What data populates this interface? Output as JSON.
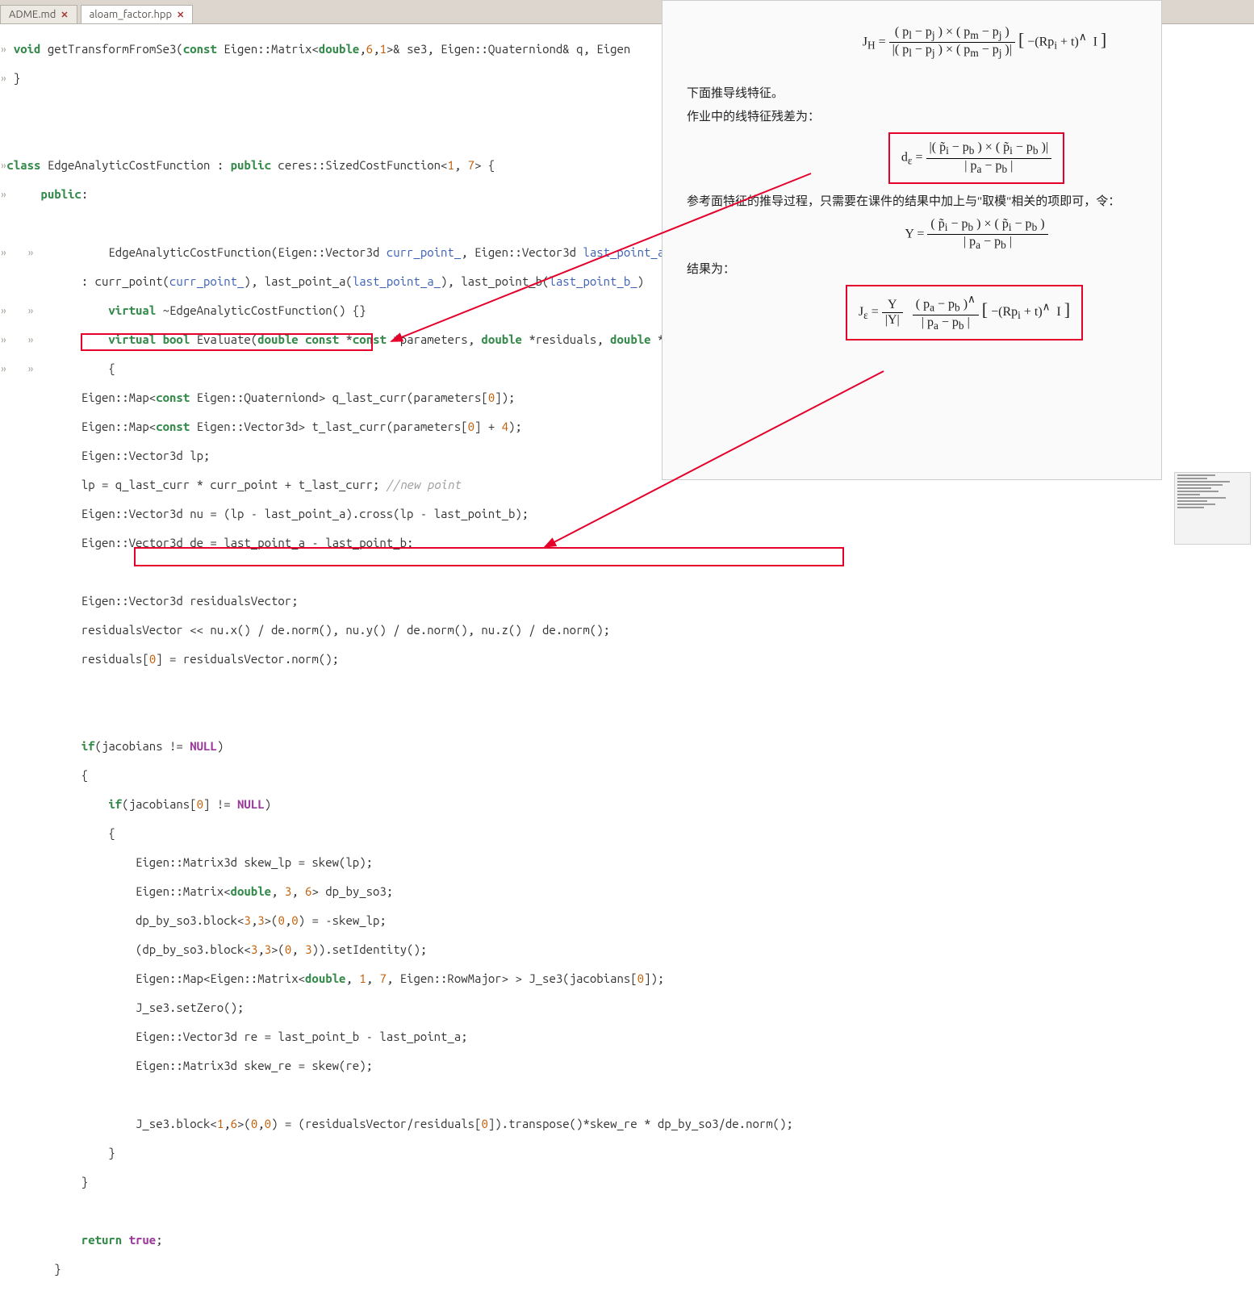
{
  "tabs": [
    {
      "label": "ADME.md",
      "active": false
    },
    {
      "label": "aloam_factor.hpp",
      "active": true
    }
  ],
  "code": {
    "l01": "void",
    "l01b": " getTransformFromSe3(",
    "l01c": "const",
    "l01d": " Eigen::Matrix<",
    "l01e": "double",
    "l01f": ",",
    "l01g": "6",
    "l01h": ",",
    "l01i": "1",
    "l01j": ">& se3, Eigen::Quaterniond& q, Eigen",
    "l02": "}",
    "l04a": "class",
    "l04b": " EdgeAnalyticCostFunction : ",
    "l04c": "public",
    "l04d": " ceres::SizedCostFunction<",
    "l04e": "1",
    "l04f": ", ",
    "l04g": "7",
    "l04h": "> {",
    "l05a": "    public",
    "l05b": ":",
    "l07": "        EdgeAnalyticCostFunction(Eigen::Vector3d ",
    "l07b": "curr_point_",
    "l07c": ", Eigen::Vector3d ",
    "l07d": "last_point_a_",
    "l08": "            : curr_point(",
    "l08b": "curr_point_",
    "l08c": "), last_point_a(",
    "l08d": "last_point_a_",
    "l08e": "), last_point_b(",
    "l08f": "last_point_b_",
    "l08g": ")",
    "l09a": "        virtual",
    "l09b": " ~EdgeAnalyticCostFunction() {}",
    "l10a": "        virtual",
    "l10b": " ",
    "l10c": "bool",
    "l10d": " Evaluate(",
    "l10e": "double",
    "l10f": " ",
    "l10g": "const",
    "l10h": " *",
    "l10i": "const",
    "l10j": " *parameters, ",
    "l10k": "double",
    "l10l": " *residuals, ",
    "l10m": "double",
    "l10n": " **",
    "l11": "        {",
    "l12a": "            Eigen::Map<",
    "l12b": "const",
    "l12c": " Eigen::Quaterniond> q_last_curr(parameters[",
    "l12d": "0",
    "l12e": "]);",
    "l13a": "            Eigen::Map<",
    "l13b": "const",
    "l13c": " Eigen::Vector3d> t_last_curr(parameters[",
    "l13d": "0",
    "l13e": "] + ",
    "l13f": "4",
    "l13g": ");",
    "l14": "            Eigen::Vector3d lp;",
    "l15a": "            lp = q_last_curr * curr_point + t_last_curr; ",
    "l15b": "//new point",
    "l16": "            Eigen::Vector3d nu = (lp - last_point_a).cross(lp - last_point_b);",
    "l17": "            Eigen::Vector3d de = last_point_a - last_point_b;",
    "l19": "            Eigen::Vector3d residualsVector;",
    "l20": "            residualsVector << nu.x() / de.norm(), nu.y() / de.norm(), nu.z() / de.norm();",
    "l21a": "            residuals[",
    "l21b": "0",
    "l21c": "] = residualsVector.norm();",
    "l24a": "            if",
    "l24b": "(jacobians != ",
    "l24c": "NULL",
    "l24d": ")",
    "l25": "            {",
    "l26a": "                if",
    "l26b": "(jacobians[",
    "l26c": "0",
    "l26d": "] != ",
    "l26e": "NULL",
    "l26f": ")",
    "l27": "                {",
    "l28": "                    Eigen::Matrix3d skew_lp = skew(lp);",
    "l29a": "                    Eigen::Matrix<",
    "l29b": "double",
    "l29c": ", ",
    "l29d": "3",
    "l29e": ", ",
    "l29f": "6",
    "l29g": "> dp_by_so3;",
    "l30a": "                    dp_by_so3.block<",
    "l30b": "3",
    "l30c": ",",
    "l30d": "3",
    "l30e": ">(",
    "l30f": "0",
    "l30g": ",",
    "l30h": "0",
    "l30i": ") = -skew_lp;",
    "l31a": "                    (dp_by_so3.block<",
    "l31b": "3",
    "l31c": ",",
    "l31d": "3",
    "l31e": ">(",
    "l31f": "0",
    "l31g": ", ",
    "l31h": "3",
    "l31i": ")).setIdentity();",
    "l32a": "                    Eigen::Map<Eigen::Matrix<",
    "l32b": "double",
    "l32c": ", ",
    "l32d": "1",
    "l32e": ", ",
    "l32f": "7",
    "l32g": ", Eigen::RowMajor> > J_se3(jacobians[",
    "l32h": "0",
    "l32i": "]);",
    "l33": "                    J_se3.setZero();",
    "l34": "                    Eigen::Vector3d re = last_point_b - last_point_a;",
    "l35": "                    Eigen::Matrix3d skew_re = skew(re);",
    "l37a": "                    J_se3.block<",
    "l37b": "1",
    "l37c": ",",
    "l37d": "6",
    "l37e": ">(",
    "l37f": "0",
    "l37g": ",",
    "l37h": "0",
    "l37i": ") = (residualsVector/residuals[",
    "l37j": "0",
    "l37k": "]).transpose()*skew_re * dp_by_so3/de.norm();",
    "l38": "                }",
    "l39": "            }",
    "l41a": "            return",
    "l41b": " ",
    "l41c": "true",
    "l41d": ";",
    "l42": "        }"
  },
  "doc": {
    "jh_formula": "J_H = ((p_l − p_j) × (p_m − p_j)) / |(p_l − p_j) × (p_m − p_j)| · [−(Rp_i + t)^  I]",
    "p1": "下面推导线特征。",
    "p2": "作业中的线特征残差为：",
    "de_formula": "d_ε = |(p̃_i − p_b) × (p̃_i − p_b)| / |p_a − p_b|",
    "p3": "参考面特征的推导过程，只需要在课件的结果中加上与\"取模\"相关的项即可，令：",
    "y_formula": "Y = (p̃_i − p_b) × (p̃_i − p_b) / |p_a − p_b|",
    "p4": "结果为：",
    "je_formula": "J_ε = (Y / |Y|) · ((p_a − p_b)^ / |p_a − p_b|) · [−(Rp_i + t)^  I]"
  }
}
